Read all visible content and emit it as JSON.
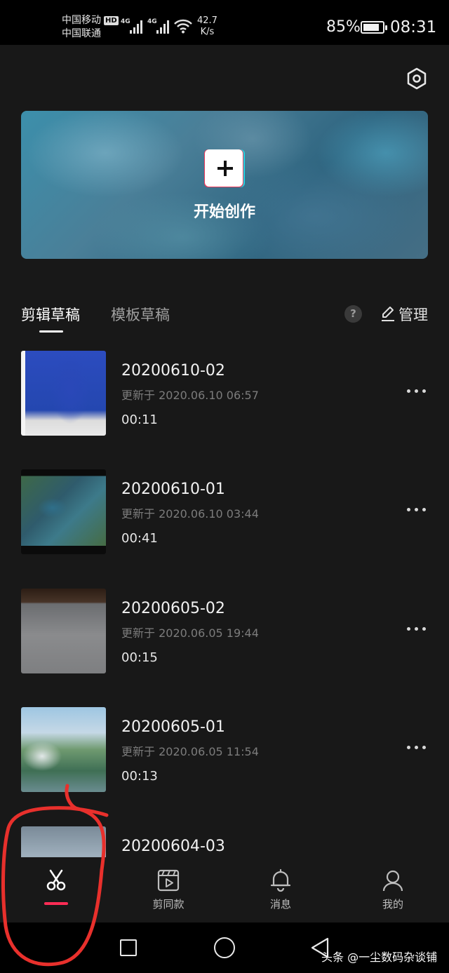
{
  "status_bar": {
    "carrier_1": "中国移动",
    "hd_badge": "HD",
    "carrier_2": "中国联通",
    "network_1": "4G",
    "network_2": "4G",
    "speed_value": "42.7",
    "speed_unit": "K/s",
    "battery_percent": "85%",
    "battery_level": 0.85,
    "time": "08:31"
  },
  "header": {
    "settings_icon": "settings-hexagon-icon"
  },
  "banner": {
    "create_label": "开始创作",
    "create_icon": "plus-icon"
  },
  "tabs": [
    {
      "label": "剪辑草稿",
      "active": true
    },
    {
      "label": "模板草稿",
      "active": false
    }
  ],
  "toolbar": {
    "help_label": "?",
    "manage_label": "管理",
    "manage_icon": "edit-pencil-icon"
  },
  "drafts": [
    {
      "title": "20200610-02",
      "updated": "更新于 2020.06.10 06:57",
      "duration": "00:11"
    },
    {
      "title": "20200610-01",
      "updated": "更新于 2020.06.10 03:44",
      "duration": "00:41"
    },
    {
      "title": "20200605-02",
      "updated": "更新于 2020.06.05 19:44",
      "duration": "00:15"
    },
    {
      "title": "20200605-01",
      "updated": "更新于 2020.06.05 11:54",
      "duration": "00:13"
    },
    {
      "title": "20200604-03",
      "updated": "",
      "duration": ""
    }
  ],
  "bottom_nav": [
    {
      "label": "",
      "icon": "scissors-icon",
      "active": true
    },
    {
      "label": "剪同款",
      "icon": "play-clapper-icon",
      "active": false
    },
    {
      "label": "消息",
      "icon": "bell-icon",
      "active": false
    },
    {
      "label": "我的",
      "icon": "person-icon",
      "active": false
    }
  ],
  "watermark": "头条 @一尘数码杂谈铺",
  "colors": {
    "background": "#181818",
    "accent": "#fe2c55",
    "annotation": "#e8302c"
  }
}
